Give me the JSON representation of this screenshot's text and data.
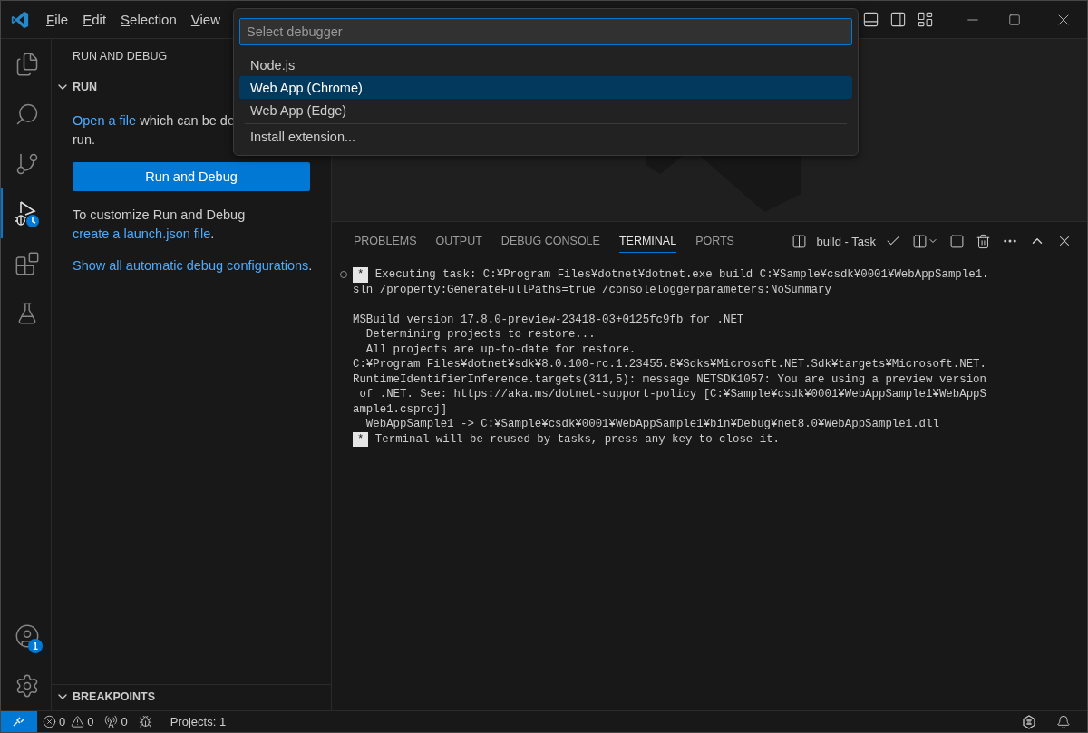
{
  "menu": [
    "File",
    "Edit",
    "Selection",
    "View"
  ],
  "quick_pick": {
    "placeholder": "Select debugger",
    "items": [
      {
        "label": "Node.js",
        "selected": false
      },
      {
        "label": "Web App (Chrome)",
        "selected": true
      },
      {
        "label": "Web App (Edge)",
        "selected": false
      }
    ],
    "footer_item": "Install extension..."
  },
  "activity_bar": {
    "items": [
      {
        "kind": "explorer",
        "selected": false
      },
      {
        "kind": "search",
        "selected": false
      },
      {
        "kind": "source-control",
        "selected": false
      },
      {
        "kind": "run-debug",
        "selected": true
      },
      {
        "kind": "extensions",
        "selected": false
      },
      {
        "kind": "testing",
        "selected": false
      }
    ],
    "account_badge": "1"
  },
  "sidebar": {
    "title": "RUN AND DEBUG",
    "section": {
      "title": "RUN",
      "expanded": true
    },
    "open_file": {
      "link": "Open a file",
      "text": " which can be de",
      "continuation": "run."
    },
    "run_button": "Run and Debug",
    "customize": {
      "text": "To customize Run and Debug ",
      "link": "create a launch.json file",
      "tail": "."
    },
    "show_all": {
      "link": "Show all automatic debug configurations",
      "tail": "."
    },
    "breakpoints": {
      "title": "BREAKPOINTS",
      "expanded": true
    }
  },
  "panel": {
    "tabs": [
      {
        "label": "PROBLEMS",
        "selected": false
      },
      {
        "label": "OUTPUT",
        "selected": false
      },
      {
        "label": "DEBUG CONSOLE",
        "selected": false
      },
      {
        "label": "TERMINAL",
        "selected": true
      },
      {
        "label": "PORTS",
        "selected": false
      }
    ],
    "terminal_name": "build - Task",
    "lines": [
      {
        "kind": "task",
        "decorated": true,
        "badge": "*",
        "text": " Executing task: C:¥Program Files¥dotnet¥dotnet.exe build C:¥Sample¥csdk¥0001¥WebAppSample1."
      },
      {
        "kind": "plain",
        "text": "sln /property:GenerateFullPaths=true /consoleloggerparameters:NoSummary"
      },
      {
        "kind": "blank"
      },
      {
        "kind": "plain",
        "text": "MSBuild version 17.8.0-preview-23418-03+0125fc9fb for .NET"
      },
      {
        "kind": "plain",
        "text": "  Determining projects to restore..."
      },
      {
        "kind": "plain",
        "text": "  All projects are up-to-date for restore."
      },
      {
        "kind": "plain",
        "text": "C:¥Program Files¥dotnet¥sdk¥8.0.100-rc.1.23455.8¥Sdks¥Microsoft.NET.Sdk¥targets¥Microsoft.NET."
      },
      {
        "kind": "plain",
        "text": "RuntimeIdentifierInference.targets(311,5): message NETSDK1057: You are using a preview version"
      },
      {
        "kind": "plain",
        "text": " of .NET. See: https://aka.ms/dotnet-support-policy [C:¥Sample¥csdk¥0001¥WebAppSample1¥WebAppS"
      },
      {
        "kind": "plain",
        "text": "ample1.csproj]"
      },
      {
        "kind": "plain",
        "text": "  WebAppSample1 -> C:¥Sample¥csdk¥0001¥WebAppSample1¥bin¥Debug¥net8.0¥WebAppSample1.dll"
      },
      {
        "kind": "task",
        "decorated": false,
        "badge": "*",
        "text": " Terminal will be reused by tasks, press any key to close it."
      }
    ]
  },
  "status_bar": {
    "errors": "0",
    "warnings": "0",
    "ports": "0",
    "projects": "Projects: 1"
  }
}
